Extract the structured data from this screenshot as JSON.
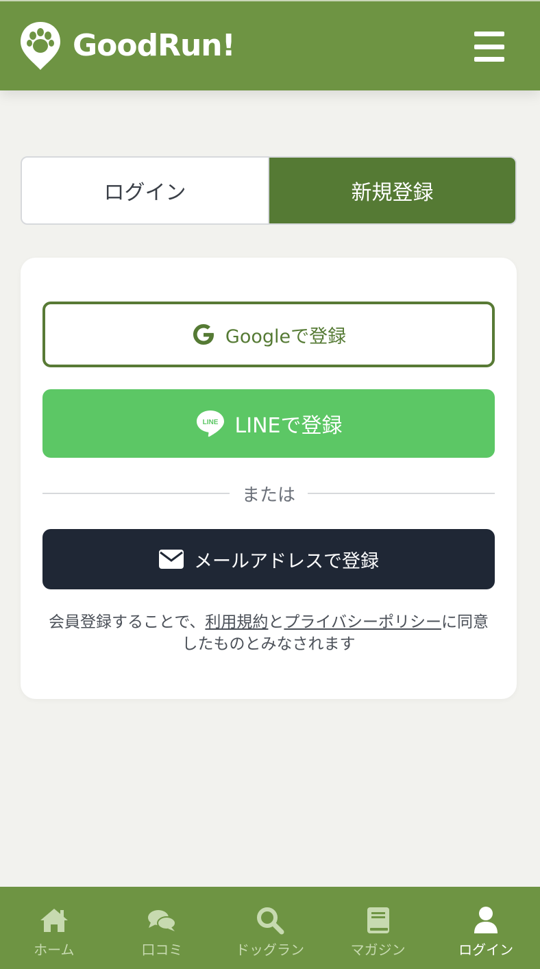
{
  "header": {
    "brand": "GoodRun!",
    "menu_icon": "hamburger-icon"
  },
  "tabs": [
    {
      "label": "ログイン",
      "active": false
    },
    {
      "label": "新規登録",
      "active": true
    }
  ],
  "signup": {
    "google_label": "Googleで登録",
    "line_label": "LINEで登録",
    "line_icon_text": "LINE",
    "divider_label": "または",
    "email_label": "メールアドレスで登録",
    "terms_prefix": "会員登録することで、",
    "terms_link": "利用規約",
    "terms_and": "と",
    "privacy_link": "プライバシーポリシー",
    "terms_suffix": "に同意したものとみなされます"
  },
  "bottom_nav": [
    {
      "label": "ホーム",
      "icon": "home-icon",
      "active": false
    },
    {
      "label": "口コミ",
      "icon": "comments-icon",
      "active": false
    },
    {
      "label": "ドッグラン",
      "icon": "search-icon",
      "active": false
    },
    {
      "label": "マガジン",
      "icon": "book-icon",
      "active": false
    },
    {
      "label": "ログイン",
      "icon": "user-icon",
      "active": true
    }
  ],
  "colors": {
    "brand_green": "#6e9443",
    "active_tab": "#557a34",
    "line_green": "#5cc765",
    "email_dark": "#1f2735",
    "background": "#f2f2ee"
  }
}
